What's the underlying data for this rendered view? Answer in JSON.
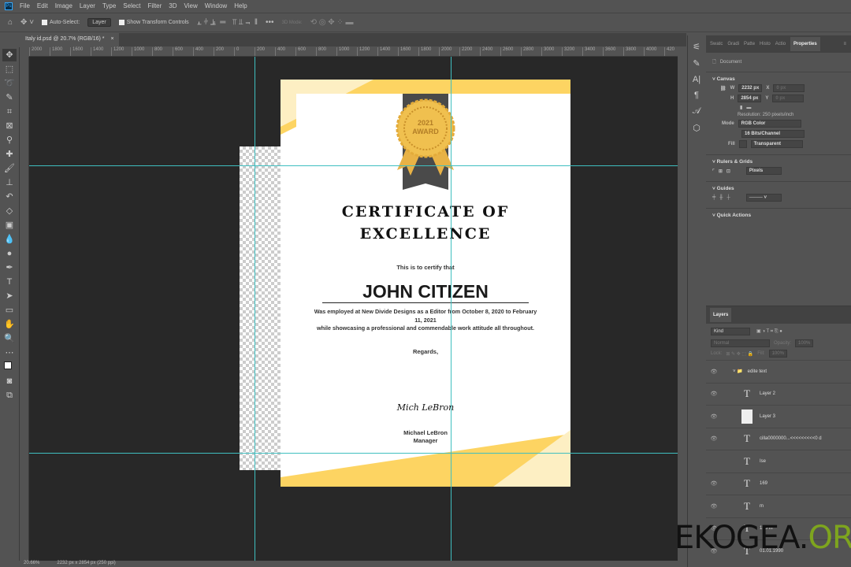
{
  "menu": [
    "File",
    "Edit",
    "Image",
    "Layer",
    "Type",
    "Select",
    "Filter",
    "3D",
    "View",
    "Window",
    "Help"
  ],
  "app_logo": "Ps",
  "options": {
    "auto_select_label": "Auto-Select:",
    "auto_select_target": "Layer",
    "show_transform_label": "Show Transform Controls",
    "mode_3d": "3D Mode:"
  },
  "doc_tab": {
    "title": "Italy id.psd @ 20.7% (RGB/16) *",
    "close": "×"
  },
  "ruler_ticks": [
    "2000",
    "1800",
    "1600",
    "1400",
    "1200",
    "1000",
    "800",
    "600",
    "400",
    "200",
    "0",
    "200",
    "400",
    "600",
    "800",
    "1000",
    "1200",
    "1400",
    "1600",
    "1800",
    "2000",
    "2200",
    "2400",
    "2600",
    "2800",
    "3000",
    "3200",
    "3400",
    "3600",
    "3800",
    "4000",
    "420"
  ],
  "certificate": {
    "medal_year": "2021",
    "medal_text": "AWARD",
    "title_line1": "CERTIFICATE OF",
    "title_line2": "EXCELLENCE",
    "intro": "This is to certify that",
    "name": "JOHN CITIZEN",
    "body1": "Was employed at New Divide Designs as a Editor from October 8, 2020 to February 11, 2021",
    "body2": "while showcasing a professional and commendable work attitude all throughout.",
    "regards": "Regards,",
    "signature": "Mich LeBron",
    "signer": "Michael LeBron",
    "signer_title": "Manager",
    "colors": {
      "yellow": "#fdd462",
      "pale": "#fdefc3",
      "ribbon": "#4a4a4a",
      "gold": "#e8b246"
    }
  },
  "status": {
    "zoom": "20.66%",
    "doc_size": "2232 px x 2854 px (250 ppi)"
  },
  "properties": {
    "tabs": [
      "Swatc",
      "Gradi",
      "Patte",
      "Histo",
      "Actio",
      "Properties"
    ],
    "doc_label": "Document",
    "canvas_title": "Canvas",
    "w_label": "W",
    "w_value": "2232 px",
    "h_label": "H",
    "h_value": "2854 px",
    "x_label": "X",
    "x_value": "0 px",
    "y_label": "Y",
    "y_value": "0 px",
    "resolution": "Resolution: 250 pixels/inch",
    "mode_label": "Mode",
    "mode_value": "RGB Color",
    "depth_value": "16 Bits/Channel",
    "fill_label": "Fill",
    "fill_value": "Transparent",
    "rulers_title": "Rulers & Grids",
    "units_value": "Pixels",
    "guides_title": "Guides",
    "quick_title": "Quick Actions"
  },
  "layers": {
    "title": "Layers",
    "kind": "Kind",
    "blend": "Normal",
    "opacity_label": "Opacity:",
    "opacity": "100%",
    "lock_label": "Lock:",
    "fill_label": "Fill:",
    "fill": "100%",
    "items": [
      {
        "name": "edite text",
        "type": "group"
      },
      {
        "name": "Layer 2",
        "type": "text"
      },
      {
        "name": "Layer 3",
        "type": "image"
      },
      {
        "name": "cilla0000000...<<<<<<<<<0 d",
        "type": "text"
      },
      {
        "name": "Ise",
        "type": "text",
        "hidden": true
      },
      {
        "name": "169",
        "type": "text"
      },
      {
        "name": "m",
        "type": "text"
      },
      {
        "name": "125 m",
        "type": "text"
      },
      {
        "name": "01.01.1990",
        "type": "text"
      }
    ]
  },
  "watermark": {
    "text1": "EKOGEA.",
    "text2": "ORG"
  }
}
